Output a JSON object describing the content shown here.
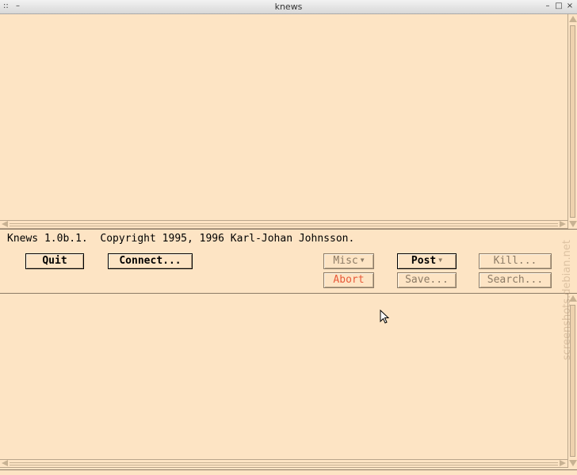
{
  "window": {
    "title": "knews",
    "menu_glyph": "::",
    "shade_glyph": "–",
    "minimize_glyph": "–",
    "maximize_glyph": "□",
    "close_glyph": "×"
  },
  "status_line": "Knews 1.0b.1.  Copyright 1995, 1996 Karl-Johan Johnsson.",
  "buttons": {
    "quit": "Quit",
    "connect": "Connect...",
    "misc": "Misc",
    "abort": "Abort",
    "post": "Post",
    "save": "Save...",
    "kill": "Kill...",
    "search": "Search..."
  },
  "menu_arrow": "▼",
  "watermark": "screenshots.debian.net",
  "colors": {
    "background": "#fde4c4",
    "abort_text": "#e85a3a",
    "disabled_text": "#8c7b66"
  }
}
